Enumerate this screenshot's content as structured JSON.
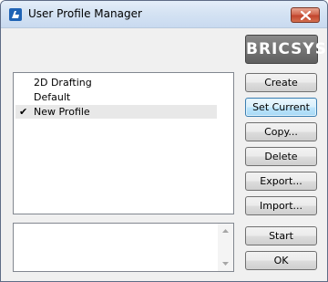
{
  "window": {
    "title": "User Profile Manager"
  },
  "logo": {
    "text": "BRICSYS"
  },
  "profiles": [
    {
      "label": "2D Drafting",
      "checked": false,
      "selected": false
    },
    {
      "label": "Default",
      "checked": false,
      "selected": false
    },
    {
      "label": "New Profile",
      "checked": true,
      "selected": true
    }
  ],
  "check_mark": "✔",
  "buttons": {
    "create": "Create",
    "set_current": "Set Current",
    "copy": "Copy...",
    "delete": "Delete",
    "export": "Export...",
    "import": "Import...",
    "start": "Start",
    "ok": "OK"
  },
  "icons": {
    "app": "bricscad-icon",
    "close": "close-icon"
  },
  "colors": {
    "title_gradient_top": "#e4eef9",
    "close_button": "#c2452e",
    "focused_button_border": "#3c7fb1",
    "selection": "#e8e8e8"
  }
}
